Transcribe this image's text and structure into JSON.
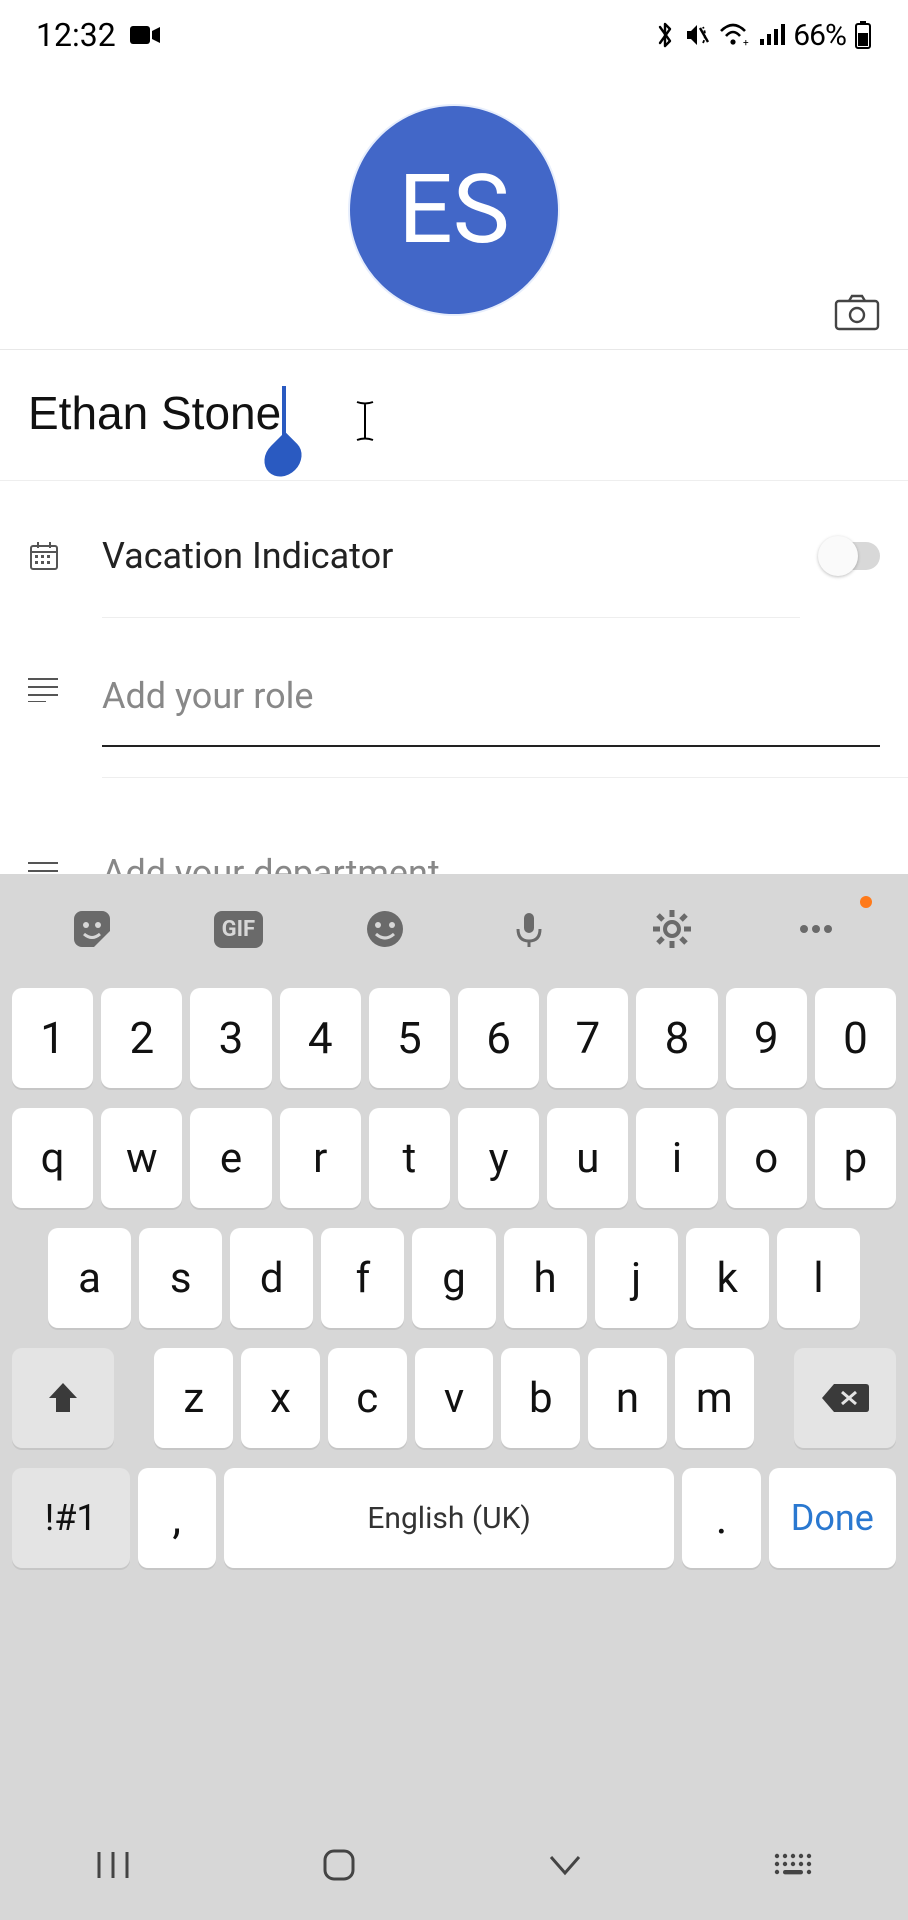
{
  "status": {
    "time": "12:32",
    "battery": "66%"
  },
  "profile": {
    "avatar_initials": "ES",
    "name": "Ethan Stone"
  },
  "fields": {
    "vacation_label": "Vacation Indicator",
    "role_placeholder": "Add your role",
    "department_placeholder": "Add your department"
  },
  "keyboard": {
    "row_num": [
      "1",
      "2",
      "3",
      "4",
      "5",
      "6",
      "7",
      "8",
      "9",
      "0"
    ],
    "row_q": [
      "q",
      "w",
      "e",
      "r",
      "t",
      "y",
      "u",
      "i",
      "o",
      "p"
    ],
    "row_a": [
      "a",
      "s",
      "d",
      "f",
      "g",
      "h",
      "j",
      "k",
      "l"
    ],
    "row_z": [
      "z",
      "x",
      "c",
      "v",
      "b",
      "n",
      "m"
    ],
    "sym": "!#1",
    "comma": ",",
    "space": "English (UK)",
    "period": ".",
    "done": "Done",
    "gif": "GIF"
  }
}
